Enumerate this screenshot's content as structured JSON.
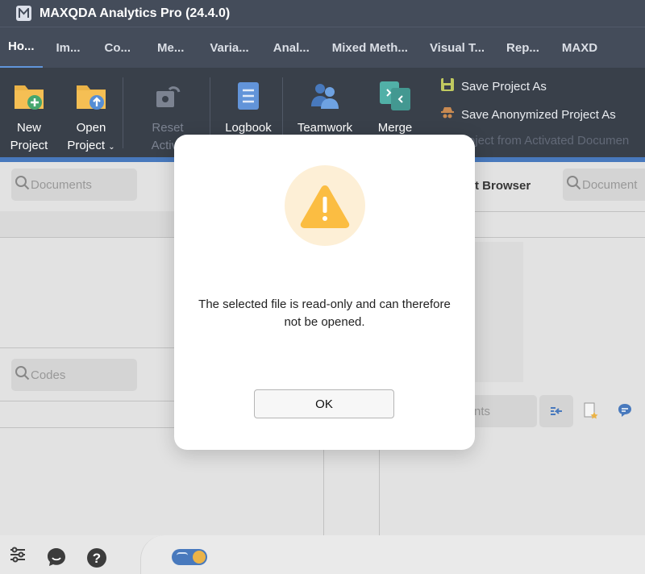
{
  "window": {
    "title": "MAXQDA Analytics Pro (24.4.0)"
  },
  "tabs": [
    "Ho...",
    "Im...",
    "Co...",
    "Me...",
    "Varia...",
    "Anal...",
    "Mixed Meth...",
    "Visual T...",
    "Rep...",
    "MAXD"
  ],
  "ribbon": {
    "new_project": [
      "New",
      "Project"
    ],
    "open_project": [
      "Open",
      "Project"
    ],
    "reset": [
      "Reset",
      "Activa"
    ],
    "logbook": "Logbook",
    "teamwork": "Teamwork",
    "merge": "Merge",
    "save_project_as": "Save Project As",
    "save_anonymized": "Save Anonymized Project As",
    "project_from_activated": "Project from Activated Documen"
  },
  "panels": {
    "documents_search": "Documents",
    "codes_search": "Codes",
    "browser_title": "t Browser",
    "browser_search": "Document",
    "segments_search": "nts"
  },
  "dialog": {
    "message": "The selected file is read-only and can therefore not be opened.",
    "ok_label": "OK"
  },
  "colors": {
    "accent": "#2f67b4",
    "warning": "#fbbd42",
    "ribbon_bg": "#1e2632",
    "titlebar_bg": "#2b3444"
  },
  "icons": [
    "app-logo-icon",
    "new-project-icon",
    "open-project-icon",
    "reset-icon",
    "logbook-icon",
    "teamwork-icon",
    "merge-icon",
    "save-icon",
    "anonymize-icon",
    "search-icon",
    "warning-icon",
    "settings-icon",
    "chat-icon",
    "help-icon",
    "theme-toggle-icon"
  ]
}
